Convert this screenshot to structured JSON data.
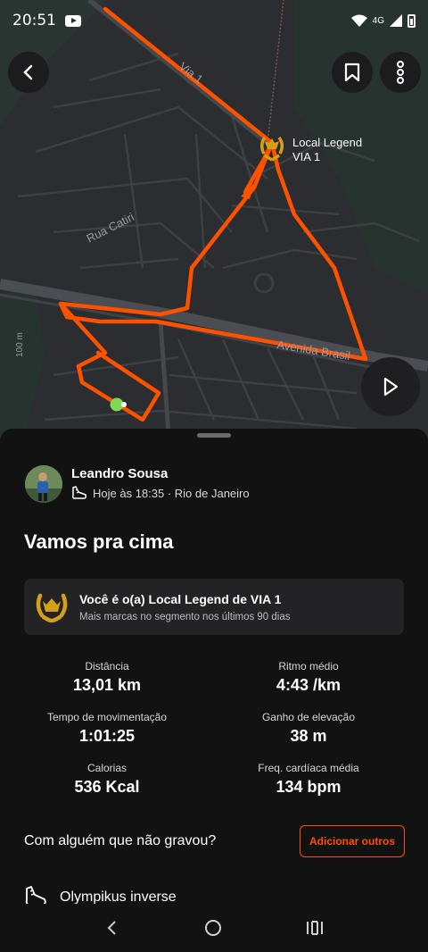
{
  "status_bar": {
    "time": "20:51",
    "network": "4G",
    "icons": [
      "youtube-icon",
      "wifi-icon",
      "signal-icon",
      "battery-icon"
    ]
  },
  "map": {
    "labels": {
      "via1": "Via 1",
      "rua_catiri": "Rua Catiri",
      "avenida_brasil": "Avenida Brasil",
      "elevation": "100 m"
    },
    "local_legend_line1": "Local Legend",
    "local_legend_line2": "VIA 1",
    "route_color": "#fc5200",
    "start_color": "#7ed957"
  },
  "activity": {
    "athlete_name": "Leandro Sousa",
    "activity_icon": "run-shoe-icon",
    "date_location": "Hoje às 18:35 · Rio de Janeiro",
    "title": "Vamos pra cima"
  },
  "legend_card": {
    "title": "Você é o(a) Local Legend de VIA 1",
    "subtitle": "Mais marcas no segmento nos últimos 90 dias"
  },
  "stats": [
    {
      "label": "Distância",
      "value": "13,01 km"
    },
    {
      "label": "Ritmo médio",
      "value": "4:43 /km"
    },
    {
      "label": "Tempo de movimentação",
      "value": "1:01:25"
    },
    {
      "label": "Ganho de elevação",
      "value": "38 m"
    },
    {
      "label": "Calorias",
      "value": "536 Kcal"
    },
    {
      "label": "Freq. cardíaca média",
      "value": "134 bpm"
    }
  ],
  "group": {
    "prompt": "Com alguém que não gravou?",
    "button": "Adicionar outros"
  },
  "gear": {
    "label": "Olympikus inverse"
  },
  "colors": {
    "accent": "#fc5200",
    "background": "#121212",
    "card": "#232325",
    "gold": "#d4a017"
  }
}
